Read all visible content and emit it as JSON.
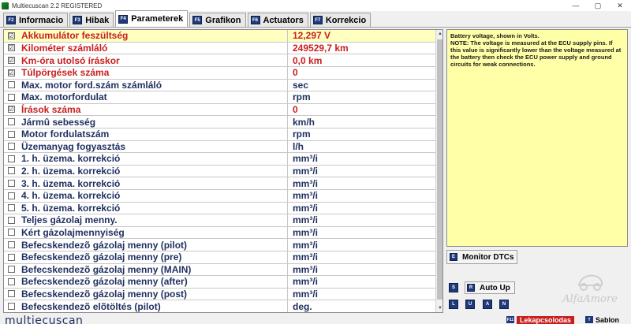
{
  "window": {
    "title": "Multiecuscan 2.2 REGISTERED",
    "controls": [
      "—",
      "▢",
      "✕"
    ]
  },
  "tabs": [
    {
      "key": "F2",
      "label": "Informacio",
      "active": false
    },
    {
      "key": "F3",
      "label": "Hibak",
      "active": false
    },
    {
      "key": "F4",
      "label": "Parameterek",
      "active": true
    },
    {
      "key": "F5",
      "label": "Grafikon",
      "active": false
    },
    {
      "key": "F6",
      "label": "Actuators",
      "active": false
    },
    {
      "key": "F7",
      "label": "Korrekcio",
      "active": false
    }
  ],
  "parameters": [
    {
      "checked": true,
      "name": "Akkumulátor feszültség",
      "value": "12,297 V",
      "red": true,
      "selected": true
    },
    {
      "checked": true,
      "name": "Kilométer számláló",
      "value": "249529,7 km",
      "red": true,
      "selected": false
    },
    {
      "checked": true,
      "name": "Km-óra utolsó íráskor",
      "value": "0,0 km",
      "red": true,
      "selected": false
    },
    {
      "checked": true,
      "name": "Túlpörgések száma",
      "value": "0",
      "red": true,
      "selected": false
    },
    {
      "checked": false,
      "name": "Max. motor ford.szám számláló",
      "value": "sec",
      "red": false,
      "selected": false
    },
    {
      "checked": false,
      "name": "Max. motorfordulat",
      "value": "rpm",
      "red": false,
      "selected": false
    },
    {
      "checked": true,
      "name": "Írások száma",
      "value": "0",
      "red": true,
      "selected": false
    },
    {
      "checked": false,
      "name": "Jármû sebesség",
      "value": "km/h",
      "red": false,
      "selected": false
    },
    {
      "checked": false,
      "name": "Motor fordulatszám",
      "value": "rpm",
      "red": false,
      "selected": false
    },
    {
      "checked": false,
      "name": "Üzemanyag fogyasztás",
      "value": "l/h",
      "red": false,
      "selected": false
    },
    {
      "checked": false,
      "name": "1. h. üzema. korrekció",
      "value": "mm³/i",
      "red": false,
      "selected": false
    },
    {
      "checked": false,
      "name": "2. h. üzema. korrekció",
      "value": "mm³/i",
      "red": false,
      "selected": false
    },
    {
      "checked": false,
      "name": "3. h. üzema. korrekció",
      "value": "mm³/i",
      "red": false,
      "selected": false
    },
    {
      "checked": false,
      "name": "4. h. üzema. korrekció",
      "value": "mm³/i",
      "red": false,
      "selected": false
    },
    {
      "checked": false,
      "name": "5. h. üzema. korrekció",
      "value": "mm³/i",
      "red": false,
      "selected": false
    },
    {
      "checked": false,
      "name": "Teljes gázolaj menny.",
      "value": "mm³/i",
      "red": false,
      "selected": false
    },
    {
      "checked": false,
      "name": "Kért gázolajmennyiség",
      "value": "mm³/i",
      "red": false,
      "selected": false
    },
    {
      "checked": false,
      "name": "Befecskendezõ gázolaj menny (pilot)",
      "value": "mm³/i",
      "red": false,
      "selected": false
    },
    {
      "checked": false,
      "name": "Befecskendezõ gázolaj menny (pre)",
      "value": "mm³/i",
      "red": false,
      "selected": false
    },
    {
      "checked": false,
      "name": "Befecskendezõ gázolaj menny (MAIN)",
      "value": "mm³/i",
      "red": false,
      "selected": false
    },
    {
      "checked": false,
      "name": "Befecskendezõ gázolaj menny (after)",
      "value": "mm³/i",
      "red": false,
      "selected": false
    },
    {
      "checked": false,
      "name": "Befecskendezõ gázolaj menny (post)",
      "value": "mm³/i",
      "red": false,
      "selected": false
    },
    {
      "checked": false,
      "name": "Befecskendezõ elõtöltés (pilot)",
      "value": "deg.",
      "red": false,
      "selected": false
    }
  ],
  "info": {
    "text": "Battery voltage, shown in Volts.\nNOTE: The voltage is measured at the ECU supply pins. If this value is significantly lower than the voltage measured at the battery then check the ECU power supply and ground circuits for weak connections."
  },
  "buttons": {
    "monitor_key": "E",
    "monitor_label": "Monitor DTCs",
    "autoup_s": "S",
    "autoup_r": "R",
    "autoup_label": "Auto Up",
    "nav_keys": [
      "L",
      "U",
      "A",
      "N"
    ]
  },
  "watermark": "AlfaAmore",
  "footer": {
    "brand": "multiecuscan",
    "btn1_key": "F11",
    "btn1_label": "Lekapcsolodas",
    "btn2_key": "T",
    "btn2_label": "Sablon"
  },
  "colors": {
    "selected_row": "#ffffc0",
    "info_bg": "#ffffa8",
    "red_text": "#c81e1e",
    "navy_text": "#1f2f5f"
  }
}
